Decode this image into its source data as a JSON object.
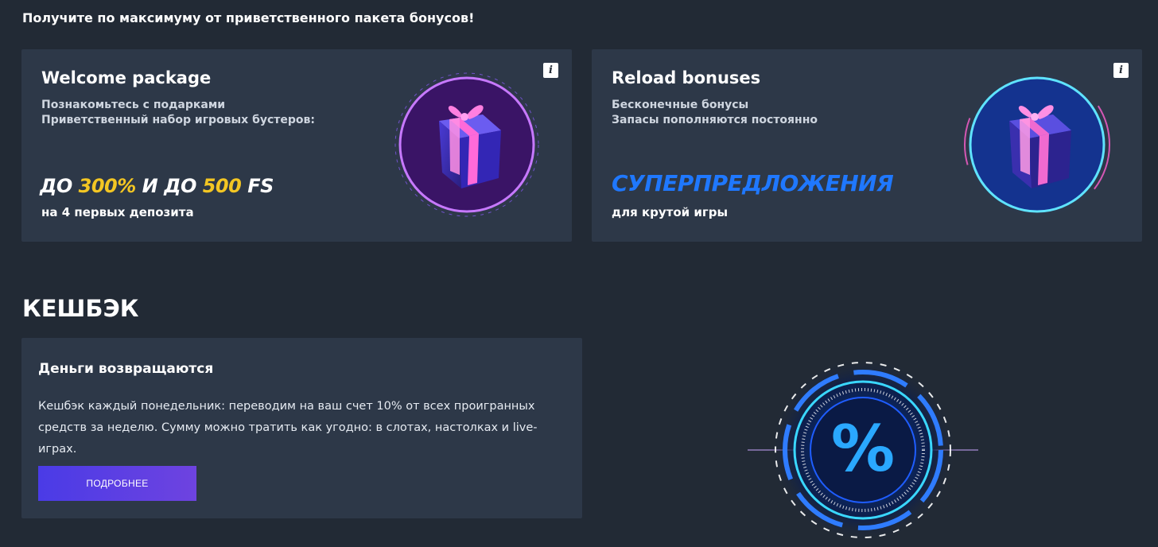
{
  "page": {
    "heading": "Получите по максимуму от приветственного пакета бонусов!"
  },
  "welcome_card": {
    "title": "Welcome package",
    "line1": "Познакомьтесь с подарками",
    "line2": "Приветственный набор игровых бустеров:",
    "promo_prefix": "ДО ",
    "promo_value1": "300%",
    "promo_middle": " И ДО ",
    "promo_value2": "500",
    "promo_suffix": " FS",
    "footer": "на 4 первых депозита",
    "info_label": "i"
  },
  "reload_card": {
    "title": "Reload bonuses",
    "line1": "Бесконечные бонусы",
    "line2": "Запасы пополняются постоянно",
    "promo": "СУПЕРПРЕДЛОЖЕНИЯ",
    "footer": "для крутой игры",
    "info_label": "i"
  },
  "cashback": {
    "section_title": "КЕШБЭК",
    "card_title": "Деньги возвращаются",
    "description": "Кешбэк каждый понедельник: переводим на ваш счет 10% от всех проигранных средств за неделю. Сумму можно тратить как угодно: в слотах, настолках и live-играх.",
    "button_label": "ПОДРОБНЕЕ",
    "art_symbol": "%"
  },
  "colors": {
    "background": "#222a35",
    "card": "#2d3848",
    "accent_yellow": "#f3c623",
    "accent_blue": "#1f78ff",
    "button_start": "#4a3be6",
    "button_end": "#6e43e0"
  },
  "icons": {
    "info": "info-icon",
    "welcome_art": "gift-box-purple-ring-icon",
    "reload_art": "gift-box-blue-ring-icon",
    "cashback_art": "percent-ring-icon"
  }
}
